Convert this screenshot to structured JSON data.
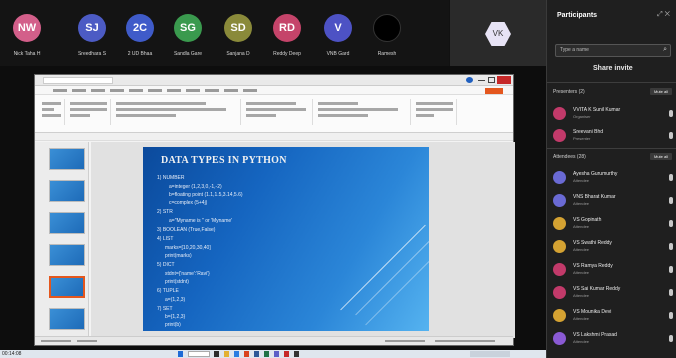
{
  "gallery": {
    "participants": [
      {
        "initials": "NW",
        "color": "#d35f8a",
        "name": "Nick Taha H"
      },
      {
        "initials": "SJ",
        "color": "#4c5bc4",
        "name": "Sreedhara S"
      },
      {
        "initials": "2C",
        "color": "#3f5bc9",
        "name": "2 UD Bhaa"
      },
      {
        "initials": "SG",
        "color": "#3a9a4e",
        "name": "Sandla Gare"
      },
      {
        "initials": "SD",
        "color": "#8a8a3a",
        "name": "Sanjana D"
      },
      {
        "initials": "RD",
        "color": "#c5446a",
        "name": "Reddy Deep"
      },
      {
        "initials": "V",
        "color": "#4d52c4",
        "name": "VNB Gard"
      },
      {
        "initials": "",
        "color": "#000000",
        "name": "Ramesh"
      }
    ],
    "self": {
      "initials": "VK"
    }
  },
  "slide": {
    "title": "DATA TYPES IN PYTHON",
    "lines": [
      "1) NUMBER",
      "a=integer (1,2,3,0,-1,-2)",
      "b=floating point (1.1,1.5,3.14,5.6)",
      "c=complex (5+4j)",
      "2) STR",
      "a=\"Myname is \" or 'Myname'",
      "3) BOOLEAN (True,False)",
      "4) LIST",
      "marks=[10,20,30,40]",
      "print(marks)",
      "5) DICT",
      "stdnt={'name':'Ravi'}",
      "print(stdnt)",
      "6) TUPLE",
      "a=(1,2,3)",
      "7) SET",
      "b={1,2,3}",
      "print(b)"
    ]
  },
  "taskbar": {
    "timecode": "00:14:08"
  },
  "panel": {
    "title": "Participants",
    "header_icons": "⤢ ✕",
    "search_placeholder": "Type a name",
    "share_invite": "Share invite",
    "presenters_label": "Presenters (2)",
    "presenters_btn": "Mute all",
    "attendees_label": "Attendees (28)",
    "attendees_btn": "Mute all",
    "presenters": [
      {
        "name": "VVITA K Sunil Kumar",
        "role": "Organiser",
        "color": "#c23a6a"
      },
      {
        "name": "Sreevani Bhd",
        "role": "Presenter",
        "color": "#c23a6a"
      }
    ],
    "attendees": [
      {
        "name": "Ayesha Gurumurthy",
        "role": "Attendee",
        "color": "#6a6ad4"
      },
      {
        "name": "VNS Bharat Kumar",
        "role": "Attendee",
        "color": "#6a6ad4"
      },
      {
        "name": "VS Gopinath",
        "role": "Attendee",
        "color": "#d4a232"
      },
      {
        "name": "VS Swathi Reddy",
        "role": "Attendee",
        "color": "#d4a232"
      },
      {
        "name": "VS Ramya Reddy",
        "role": "Attendee",
        "color": "#c23a6a"
      },
      {
        "name": "VS Sai Kumar Reddy",
        "role": "Attendee",
        "color": "#c23a6a"
      },
      {
        "name": "VS Mounika Devi",
        "role": "Attendee",
        "color": "#d4a232"
      },
      {
        "name": "VS Lakshmi Prasad",
        "role": "Attendee",
        "color": "#8a5ad4"
      }
    ]
  }
}
